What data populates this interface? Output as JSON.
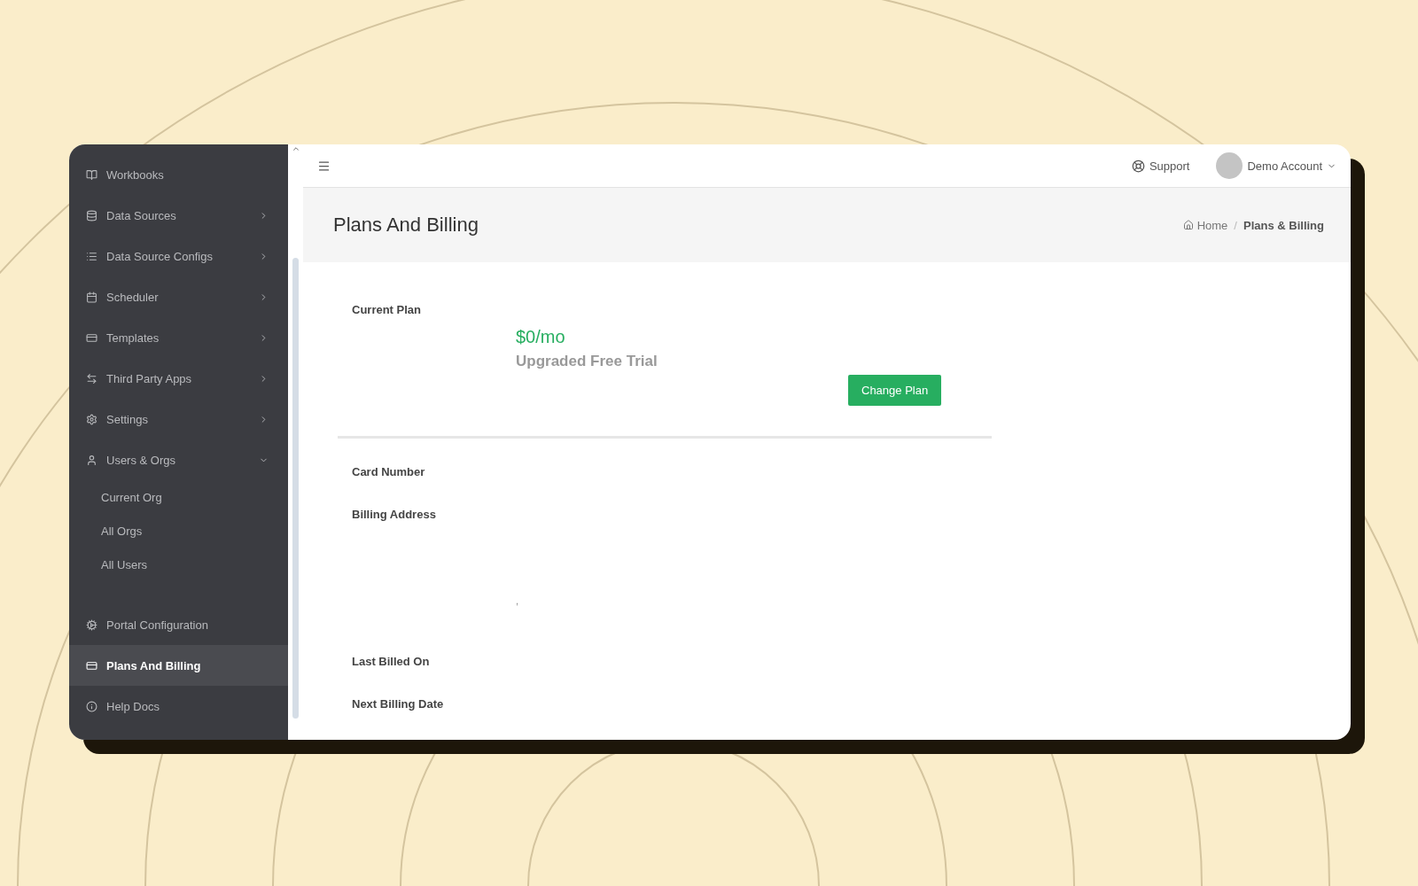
{
  "sidebar": {
    "items": [
      {
        "kind": "link",
        "label": "Workbooks",
        "selected": false
      },
      {
        "kind": "group",
        "label": "Data Sources",
        "selected": false,
        "expanded": false
      },
      {
        "kind": "group",
        "label": "Data Source Configs",
        "selected": false,
        "expanded": false
      },
      {
        "kind": "group",
        "label": "Scheduler",
        "selected": false,
        "expanded": false
      },
      {
        "kind": "group",
        "label": "Templates",
        "selected": false,
        "expanded": false
      },
      {
        "kind": "group",
        "label": "Third Party Apps",
        "selected": false,
        "expanded": false
      },
      {
        "kind": "group",
        "label": "Settings",
        "selected": false,
        "expanded": false
      },
      {
        "kind": "group",
        "label": "Users & Orgs",
        "selected": false,
        "expanded": true,
        "children": [
          {
            "label": "Current Org",
            "selected": false
          },
          {
            "label": "All Orgs",
            "selected": false
          },
          {
            "label": "All Users",
            "selected": false
          }
        ]
      },
      {
        "kind": "link",
        "label": "Portal Configuration",
        "selected": false
      },
      {
        "kind": "link",
        "label": "Plans And Billing",
        "selected": true
      },
      {
        "kind": "link",
        "label": "Help Docs",
        "selected": false
      }
    ]
  },
  "topbar": {
    "support": "Support",
    "account": "Demo Account"
  },
  "header": {
    "title": "Plans And Billing",
    "breadcrumb_separator": "/",
    "breadcrumb": [
      {
        "label": "Home",
        "selected": false
      },
      {
        "label": "Plans & Billing",
        "selected": true
      }
    ]
  },
  "plan": {
    "label": "Current Plan",
    "price": "$0/mo",
    "name": "Upgraded Free Trial",
    "button": "Change Plan"
  },
  "fields": [
    {
      "label": "Card Number"
    },
    {
      "label": "Billing Address",
      "value": ","
    },
    {
      "label": "Last Billed On"
    },
    {
      "label": "Next Billing Date"
    }
  ]
}
